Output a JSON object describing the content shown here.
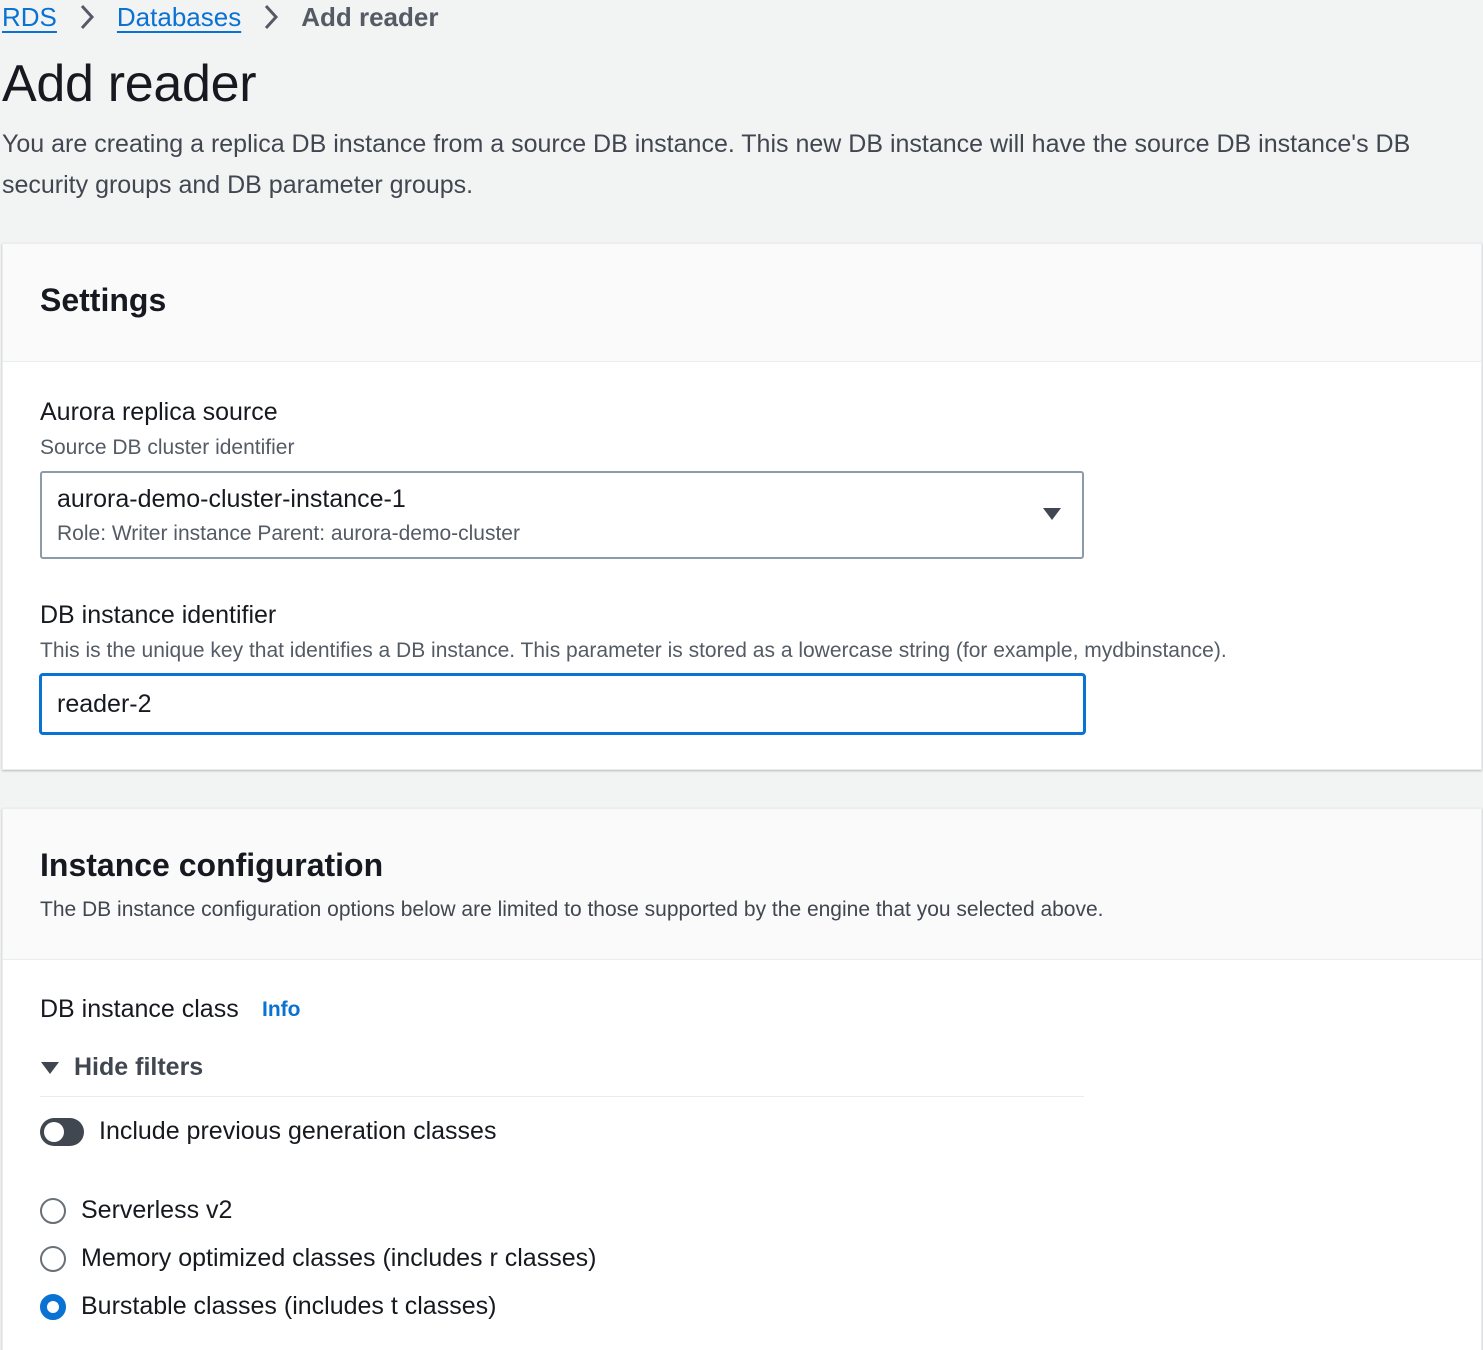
{
  "breadcrumb": {
    "items": [
      {
        "label": "RDS"
      },
      {
        "label": "Databases"
      }
    ],
    "current": "Add reader"
  },
  "page": {
    "title": "Add reader",
    "description": "You are creating a replica DB instance from a source DB instance. This new DB instance will have the source DB instance's DB security groups and DB parameter groups."
  },
  "settings": {
    "title": "Settings",
    "replica_source": {
      "label": "Aurora replica source",
      "description": "Source DB cluster identifier",
      "selected_value": "aurora-demo-cluster-instance-1",
      "selected_meta": "Role: Writer instance Parent: aurora-demo-cluster"
    },
    "instance_identifier": {
      "label": "DB instance identifier",
      "description": "This is the unique key that identifies a DB instance. This parameter is stored as a lowercase string (for example, mydbinstance).",
      "value": "reader-2"
    }
  },
  "instance_config": {
    "title": "Instance configuration",
    "subtitle": "The DB instance configuration options below are limited to those supported by the engine that you selected above.",
    "class_label": "DB instance class",
    "info_label": "Info",
    "filters_label": "Hide filters",
    "toggle_label": "Include previous generation classes",
    "toggle_on": false,
    "options": [
      {
        "label": "Serverless v2",
        "checked": false
      },
      {
        "label": "Memory optimized classes (includes r classes)",
        "checked": false
      },
      {
        "label": "Burstable classes (includes t classes)",
        "checked": true
      }
    ]
  },
  "colors": {
    "accent": "#0972d3",
    "background": "#f2f3f3",
    "text": "#16191f"
  }
}
